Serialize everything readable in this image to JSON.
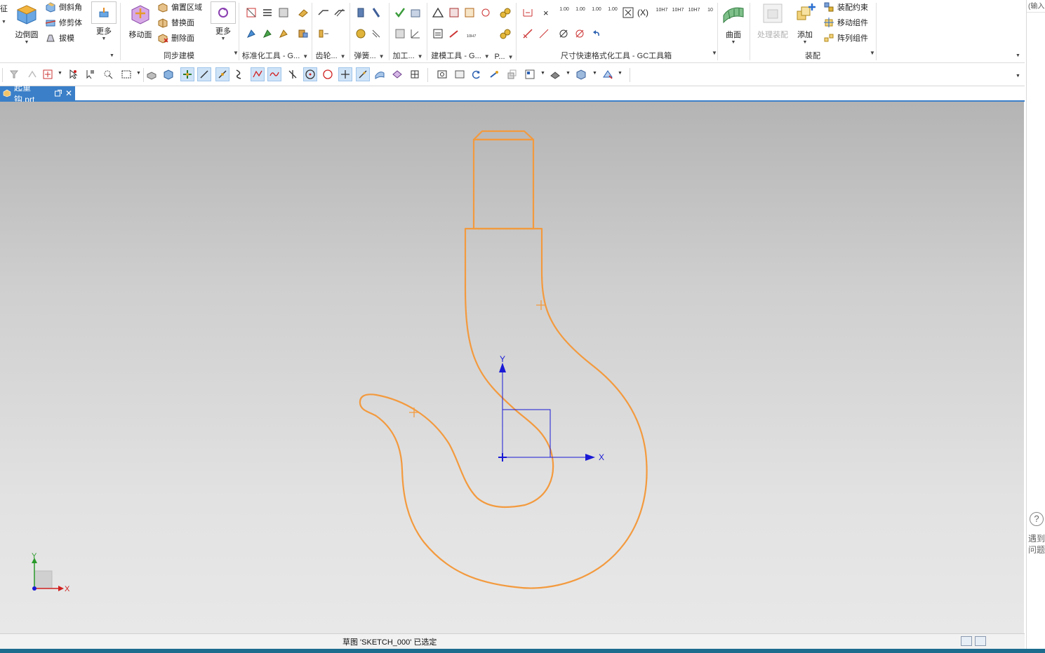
{
  "ribbon": {
    "cut_label": "征",
    "group1": {
      "big_label": "边倒圆",
      "items": [
        "倒斜角",
        "修剪体",
        "拔模"
      ],
      "more_label": "更多"
    },
    "group2": {
      "title": "同步建模",
      "big_label": "移动面",
      "items": [
        "偏置区域",
        "替换面",
        "删除面"
      ],
      "more_label": "更多"
    },
    "group3": {
      "title": "标准化工具 - G..."
    },
    "group4": {
      "title": "齿轮..."
    },
    "group5": {
      "title": "弹簧..."
    },
    "group6": {
      "title": "加工..."
    },
    "group7": {
      "title": "建模工具 - G..."
    },
    "group8": {
      "title": "P..."
    },
    "group9": {
      "title": "尺寸快速格式化工具 - GC工具箱",
      "dim_labels": [
        "1.00",
        "1.00",
        "1.00",
        "1.00",
        "10H7",
        "10H7",
        "10H7",
        "10"
      ]
    },
    "group10": {
      "big_label": "曲面"
    },
    "group11": {
      "title": "装配",
      "process_label": "处理装配",
      "add_label": "添加",
      "items": [
        "装配约束",
        "移动组件",
        "阵列组件"
      ]
    }
  },
  "tab": {
    "file_name": "起重钩.prt",
    "close": "✕"
  },
  "viewport": {
    "sketch_axis_x": "X",
    "sketch_axis_y": "Y",
    "triad_x": "X",
    "triad_y": "Y",
    "curve_color": "#f39a3e",
    "axis_color": "#1a1ad6"
  },
  "status": {
    "message": "草图 'SKETCH_000' 已选定"
  },
  "right_panel": {
    "top_label": "(输入",
    "help_icon": "?",
    "help_text": "遇到问题"
  }
}
